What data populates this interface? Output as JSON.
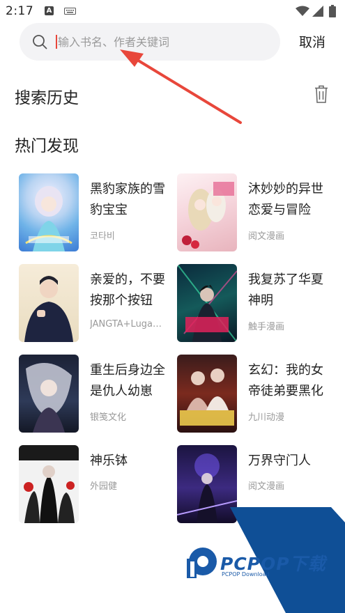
{
  "status_bar": {
    "time": "2:17",
    "a_icon_letter": "A",
    "icons": [
      "a-notification-icon",
      "keyboard-icon",
      "wifi-icon",
      "signal-icon",
      "battery-icon"
    ]
  },
  "search": {
    "placeholder": "输入书名、作者关键词",
    "value": "",
    "cancel_label": "取消"
  },
  "history": {
    "title": "搜索历史",
    "clear_icon": "trash-icon"
  },
  "hot": {
    "title": "热门发现",
    "items": [
      {
        "title": "黑豹家族的雪豹宝宝",
        "author": "코타비"
      },
      {
        "title": "沐妙妙的异世恋爱与冒险",
        "author": "阅文漫画"
      },
      {
        "title": "亲爱的，不要按那个按钮",
        "author": "JANGTA+Luga+..."
      },
      {
        "title": "我复苏了华夏神明",
        "author": "触手漫画"
      },
      {
        "title": "重生后身边全是仇人幼崽",
        "author": "银笺文化"
      },
      {
        "title": "玄幻：我的女帝徒弟要黑化",
        "author": "九川动漫"
      },
      {
        "title": "神乐钵",
        "author": "外园健"
      },
      {
        "title": "万界守门人",
        "author": "阅文漫画"
      }
    ]
  },
  "watermark": {
    "text": "PCPOP下载",
    "sub": "PCPOP Download"
  },
  "colors": {
    "cursor": "#e8473b",
    "annotation_arrow": "#e8473b",
    "watermark_blue": "#1a5aa8"
  }
}
